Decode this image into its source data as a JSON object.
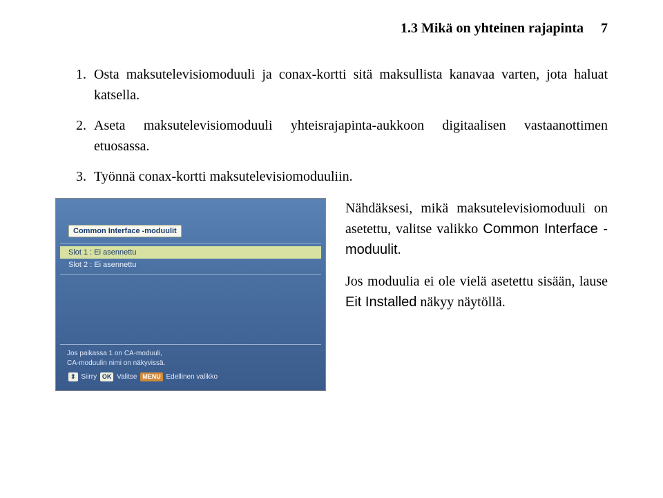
{
  "header": {
    "section_title": "1.3 Mikä on yhteinen rajapinta",
    "page_number": "7"
  },
  "steps": [
    {
      "num": "1.",
      "text": "Osta maksutelevisiomoduuli ja conax-kortti sitä maksullista kanavaa varten, jota haluat katsella."
    },
    {
      "num": "2.",
      "text": "Aseta maksutelevisiomoduuli yhteisrajapinta-aukkoon digitaalisen vastaanottimen etuosassa."
    },
    {
      "num": "3.",
      "text": "Työnnä conax-kortti maksutelevisiomoduuliin."
    }
  ],
  "screenshot": {
    "title": "Common Interface -moduulit",
    "slot1": "Slot 1 : Ei asennettu",
    "slot2": "Slot 2 : Ei asennettu",
    "hint1": "Jos paikassa 1 on CA-moduuli,",
    "hint2": "CA-moduulin nimi on näkyvissä.",
    "nav_siirry": "Siirry",
    "nav_ok": "OK",
    "nav_valitse": "Valitse",
    "nav_menu": "MENU",
    "nav_prev": "Edellinen valikko"
  },
  "side": {
    "p1_a": "Nähdäksesi, mikä maksutelevisiomoduuli on asetettu, valitse valikko ",
    "p1_sans": "Common Interface -moduulit",
    "p1_b": ".",
    "p2_a": "Jos moduulia ei ole vielä asetettu sisään, lause ",
    "p2_sans": "Eit Installed",
    "p2_b": " näkyy näytöllä."
  }
}
